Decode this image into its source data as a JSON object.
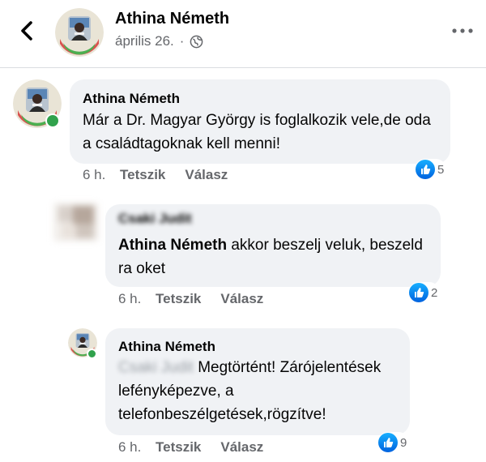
{
  "post": {
    "author": "Athina Németh",
    "date": "április 26.",
    "separator": "·",
    "privacy_icon": "globe-icon"
  },
  "comments": [
    {
      "author": "Athina Németh",
      "text": "Már a Dr. Magyar György is foglalkozik vele,de oda a családtagoknak kell menni!",
      "time": "6 h.",
      "like_label": "Tetszik",
      "reply_label": "Válasz",
      "reactions": "5"
    },
    {
      "author": "Csaki Judit",
      "mention": "Athina Németh",
      "text": "akkor beszelj veluk, beszeld ra oket",
      "time": "6 h.",
      "like_label": "Tetszik",
      "reply_label": "Válasz",
      "reactions": "2"
    },
    {
      "author": "Athina Németh",
      "mention": "Csaki Judit",
      "text": "Megtörtént! Zárójelentések lefényképezve, a telefonbeszélgetések,rögzítve!",
      "time": "6 h.",
      "like_label": "Tetszik",
      "reply_label": "Válasz",
      "reactions": "9"
    }
  ],
  "colors": {
    "bubble": "#f0f2f5",
    "secondary_text": "#65676b",
    "online": "#31a24c",
    "like": "#1877f2"
  }
}
